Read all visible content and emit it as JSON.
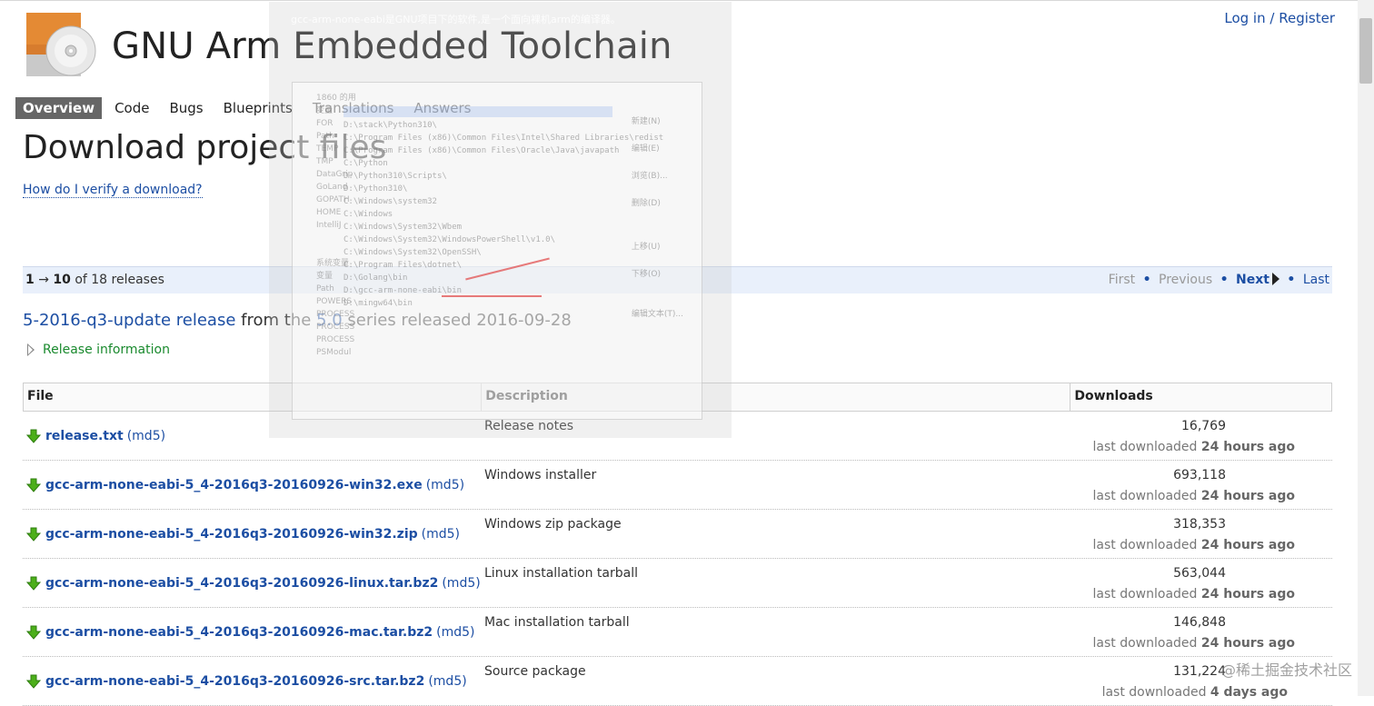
{
  "header": {
    "project_title": "GNU Arm Embedded Toolchain",
    "login_label": "Log in",
    "separator": "/",
    "register_label": "Register"
  },
  "tabs": [
    {
      "label": "Overview",
      "active": true
    },
    {
      "label": "Code"
    },
    {
      "label": "Bugs"
    },
    {
      "label": "Blueprints"
    },
    {
      "label": "Translations"
    },
    {
      "label": "Answers"
    }
  ],
  "page": {
    "title": "Download project files",
    "verify_link": "How do I verify a download?"
  },
  "batch": {
    "range_start": "1",
    "arrow": "→",
    "range_end": "10",
    "of_text": "of 18 releases",
    "first": "First",
    "previous": "Previous",
    "next": "Next",
    "last": "Last"
  },
  "release": {
    "name": "5-2016-q3-update release",
    "from_text": "from the",
    "series": "5.0",
    "series_text": "series released 2016-09-28",
    "info_label": "Release information"
  },
  "table": {
    "headers": [
      "File",
      "Description",
      "Downloads"
    ],
    "last_prefix": "last downloaded",
    "rows": [
      {
        "file": "release.txt",
        "md5": "(md5)",
        "desc": "Release notes",
        "count": "16,769",
        "when": "24 hours ago"
      },
      {
        "file": "gcc-arm-none-eabi-5_4-2016q3-20160926-win32.exe",
        "md5": "(md5)",
        "desc": "Windows installer",
        "count": "693,118",
        "when": "24 hours ago"
      },
      {
        "file": "gcc-arm-none-eabi-5_4-2016q3-20160926-win32.zip",
        "md5": "(md5)",
        "desc": "Windows zip package",
        "count": "318,353",
        "when": "24 hours ago"
      },
      {
        "file": "gcc-arm-none-eabi-5_4-2016q3-20160926-linux.tar.bz2",
        "md5": "(md5)",
        "desc": "Linux installation tarball",
        "count": "563,044",
        "when": "24 hours ago"
      },
      {
        "file": "gcc-arm-none-eabi-5_4-2016q3-20160926-mac.tar.bz2",
        "md5": "(md5)",
        "desc": "Mac installation tarball",
        "count": "146,848",
        "when": "24 hours ago"
      },
      {
        "file": "gcc-arm-none-eabi-5_4-2016q3-20160926-src.tar.bz2",
        "md5": "(md5)",
        "desc": "Source package",
        "count": "131,224",
        "when": "4 days ago"
      }
    ]
  },
  "overlay": {
    "caption": "gcc-arm-none-eabi是GNU项目下的软件,是一个面向裸机arm的编译器。",
    "paths": [
      "D:\\stack\\Python310\\",
      "C:\\Program Files (x86)\\Common Files\\Intel\\Shared Libraries\\redist",
      "C:\\Program Files (x86)\\Common Files\\Oracle\\Java\\javapath",
      "C:\\Python",
      "D:\\Python310\\Scripts\\",
      "D:\\Python310\\",
      "C:\\Windows\\system32",
      "C:\\Windows",
      "C:\\Windows\\System32\\Wbem",
      "C:\\Windows\\System32\\WindowsPowerShell\\v1.0\\",
      "C:\\Windows\\System32\\OpenSSH\\",
      "C:\\Program Files\\dotnet\\",
      "D:\\Golang\\bin",
      "D:\\gcc-arm-none-eabi\\bin",
      "D:\\mingw64\\bin"
    ],
    "buttons": [
      "新建(N)",
      "编辑(E)",
      "浏览(B)...",
      "删除(D)",
      "上移(U)",
      "下移(O)",
      "编辑文本(T)..."
    ],
    "left_labels": [
      "1860 的用",
      "变量",
      "FOR",
      "Path",
      "TEMP",
      "TMP",
      "DataGrip",
      "GoLand",
      "GOPATH",
      "HOME",
      "IntelliJ",
      "系统变量",
      "变量",
      "Path",
      "POWERS",
      "PROCESS",
      "PROCESS",
      "PROCESS",
      "PSModul"
    ]
  },
  "watermark": "@稀土掘金技术社区",
  "colors": {
    "link": "#1c4ea3",
    "green": "#1a8a2e",
    "tab_active_bg": "#666666",
    "batch_bg": "#e9f0fb"
  }
}
